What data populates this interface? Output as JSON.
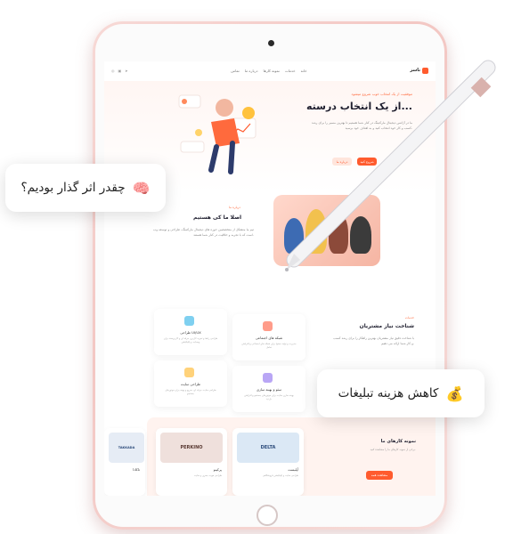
{
  "site": {
    "logo_text": "تاسز",
    "nav_links": [
      "خانه",
      "خدمات",
      "نمونه کارها",
      "درباره ما",
      "تماس"
    ],
    "hero": {
      "kicker": "موفقیت از یک انتخاب خوب شروع میشود",
      "title": "از یک انتخاب درسته...",
      "text": "ما در آژانس دیجیتال مارکتینگ در کنار شما هستیم تا بهترین مسیر را برای رشد کسب و کار خود انتخاب کنید و به اهداف خود برسید.",
      "btn_primary": "شروع کنید",
      "btn_secondary": "درباره ما"
    },
    "about": {
      "kicker": "درباره ما",
      "title": "اصلا ما کی هستیم",
      "text": "تیم ما متشکل از متخصصین حوزه های دیجیتال مارکتینگ، طراحی و توسعه وب است که با تجربه و خلاقیت در کنار شما هستند."
    },
    "services": {
      "kicker": "خدمات",
      "title": "شناخت نیاز مشتریان",
      "text": "با شناخت دقیق نیاز مشتریان بهترین راهکار را برای رشد کسب و کار شما ارائه می دهیم.",
      "btn": "مشاوره",
      "cards": [
        {
          "title": "طراحی UI/UX",
          "text": "طراحی رابط و تجربه کاربری حرفه ای و کاربرپسند برای وبسایت و اپلیکیشن"
        },
        {
          "title": "شبکه های اجتماعی",
          "text": "مدیریت و تولید محتوا برای شبکه های اجتماعی و افزایش تعامل"
        },
        {
          "title": "طراحی سایت",
          "text": "طراحی سایت حرفه ای، سریع و بهینه برای موتورهای جستجو"
        },
        {
          "title": "سئو و بهینه سازی",
          "text": "بهینه سازی سایت برای موتورهای جستجو و افزایش بازدید"
        }
      ]
    },
    "portfolio": {
      "title": "نمونه کارهای ما",
      "text": "برخی از نمونه کارهای ما را مشاهده کنید.",
      "btn": "مشاهده همه",
      "cards": [
        {
          "banner": "DELTA",
          "name": "آپلیست",
          "desc": "طراحی سایت و اپلیکیشن فروشگاهی"
        },
        {
          "banner": "PERKINO",
          "name": "پرکینو",
          "desc": "طراحی هویت بصری و سایت"
        },
        {
          "banner": "TAKKADA",
          "name": "تاکادا",
          "desc": "تولید محتوا و شبکه اجتماعی"
        }
      ]
    }
  },
  "overlays": {
    "impact_badge": {
      "emoji": "🧠",
      "label": "چقدر اثر گذار بودیم؟"
    },
    "cost_badge": {
      "emoji": "💰",
      "label": "کاهش هزینه تبلیغات"
    }
  },
  "colors": {
    "accent": "#ff5b2e",
    "frame": "#f3c7c3"
  }
}
